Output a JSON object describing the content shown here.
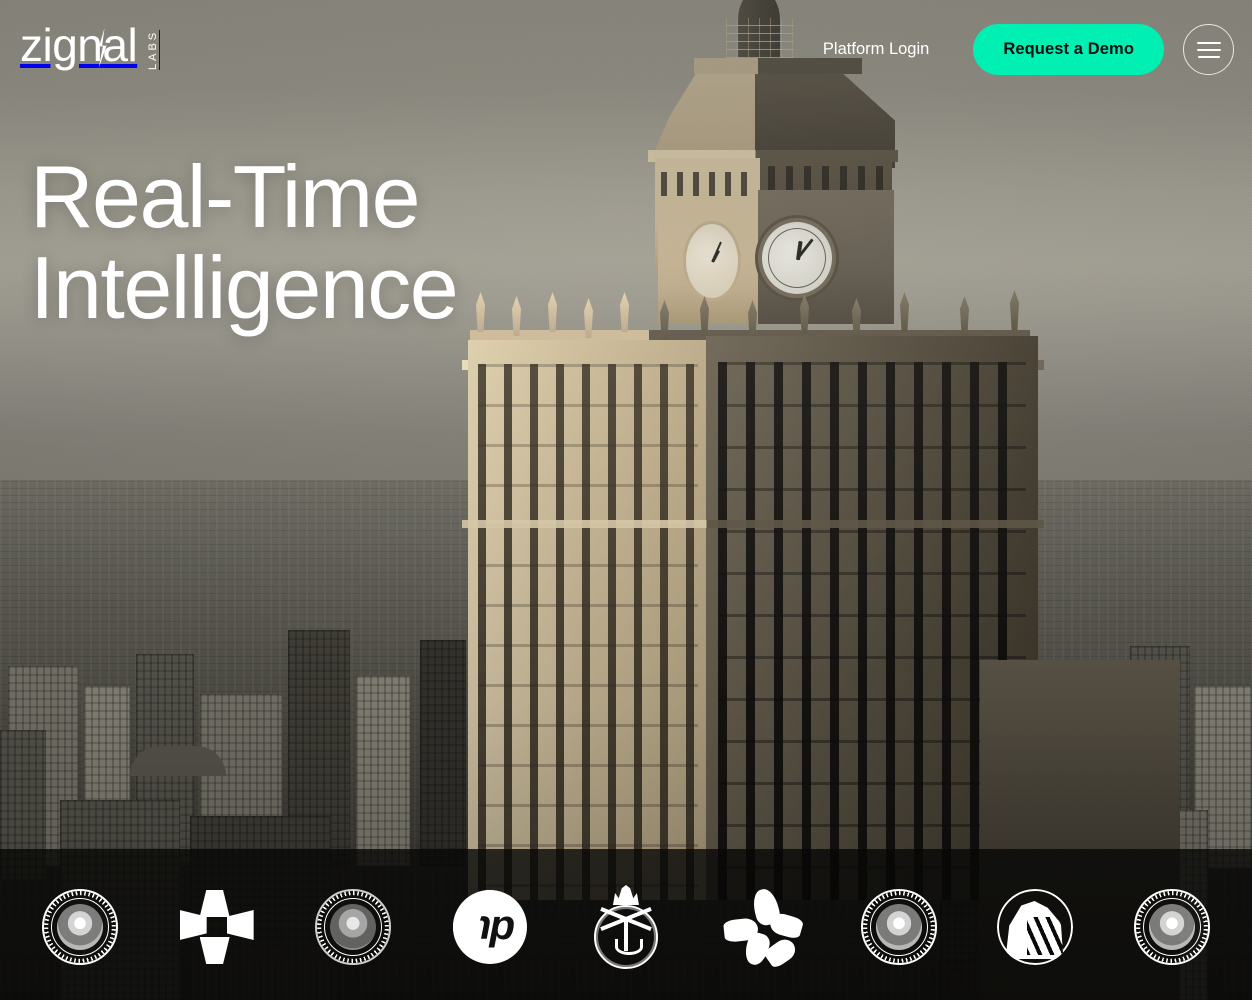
{
  "brand": {
    "name": "zignal",
    "sub": "LABS",
    "accent": "#00efb3"
  },
  "header": {
    "platform_login": "Platform Login",
    "request_demo": "Request a Demo",
    "menu_label": "Menu"
  },
  "hero": {
    "headline_line1": "Real-Time",
    "headline_line2": "Intelligence",
    "background_description": "Aerial view of the Palace of Culture and Science clock tower above a hazy city skyline"
  },
  "logo_bar": {
    "items": [
      {
        "name": "U.S. Department of Defense",
        "type": "seal"
      },
      {
        "name": "Chase",
        "type": "chase"
      },
      {
        "name": "U.S. Department of State",
        "type": "seal-muted"
      },
      {
        "name": "HP",
        "type": "hp"
      },
      {
        "name": "UK Ministry of Defence",
        "type": "mod"
      },
      {
        "name": "Yelp",
        "type": "yelp"
      },
      {
        "name": "U.S. Department of the Treasury",
        "type": "seal"
      },
      {
        "name": "Prudential",
        "type": "pru"
      },
      {
        "name": "U.S. Department of Homeland Security",
        "type": "seal"
      }
    ]
  }
}
